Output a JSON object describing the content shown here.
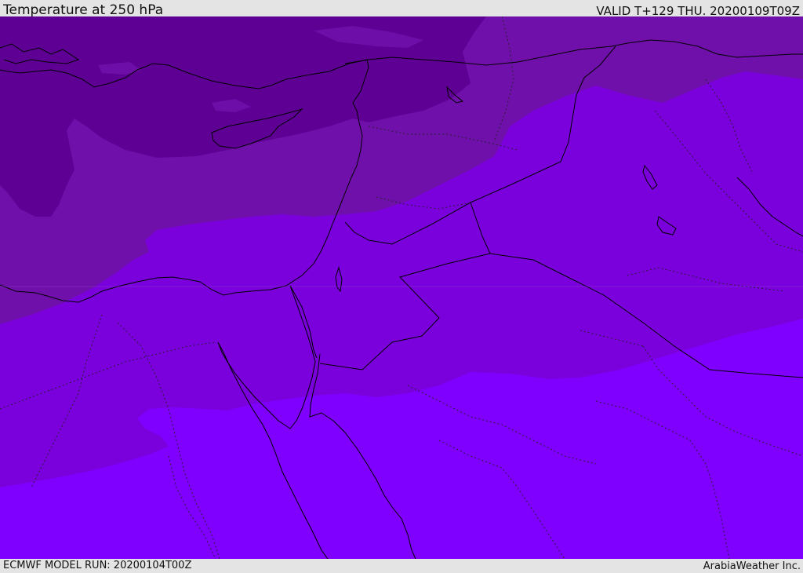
{
  "header": {
    "title": "Temperature at 250 hPa",
    "valid": "VALID T+129 THU. 20200109T09Z"
  },
  "footer": {
    "model_run": "ECMWF MODEL RUN: 20200104T00Z",
    "credit": "ArabiaWeather Inc."
  },
  "colors": {
    "band_darkest": "#5e0094",
    "band_dark": "#7010aa",
    "band_mid": "#7a00dc",
    "band_light": "#7f00ff",
    "coastline": "#000000",
    "background": "#e4e4e4"
  }
}
